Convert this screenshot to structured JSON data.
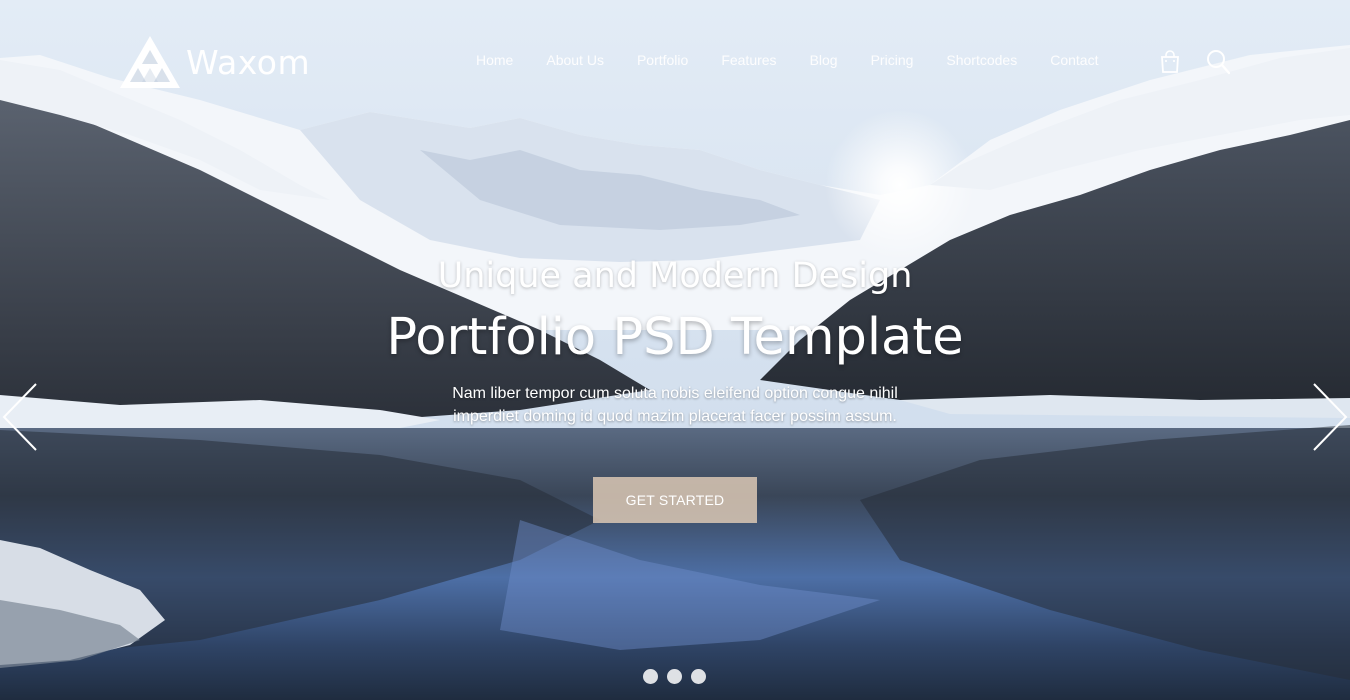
{
  "brand": {
    "name": "Waxom"
  },
  "nav": {
    "items": [
      {
        "label": "Home"
      },
      {
        "label": "About Us"
      },
      {
        "label": "Portfolio"
      },
      {
        "label": "Features"
      },
      {
        "label": "Blog"
      },
      {
        "label": "Pricing"
      },
      {
        "label": "Shortcodes"
      },
      {
        "label": "Contact"
      }
    ],
    "icons": {
      "cart": "shopping-bag-icon",
      "search": "search-icon"
    }
  },
  "hero": {
    "subtitle": "Unique and Modern Design",
    "title": "Portfolio PSD Template",
    "description_line1": "Nam liber tempor cum soluta nobis eleifend option congue nihil",
    "description_line2": "imperdiet doming id quod mazim placerat facer possim assum.",
    "cta_label": "GET STARTED",
    "background": "snowy mountain lake landscape"
  },
  "slider": {
    "prev_icon": "chevron-left-icon",
    "next_icon": "chevron-right-icon",
    "dots_count": 3
  },
  "colors": {
    "cta_background": "#d6c4b2",
    "text": "#ffffff"
  }
}
